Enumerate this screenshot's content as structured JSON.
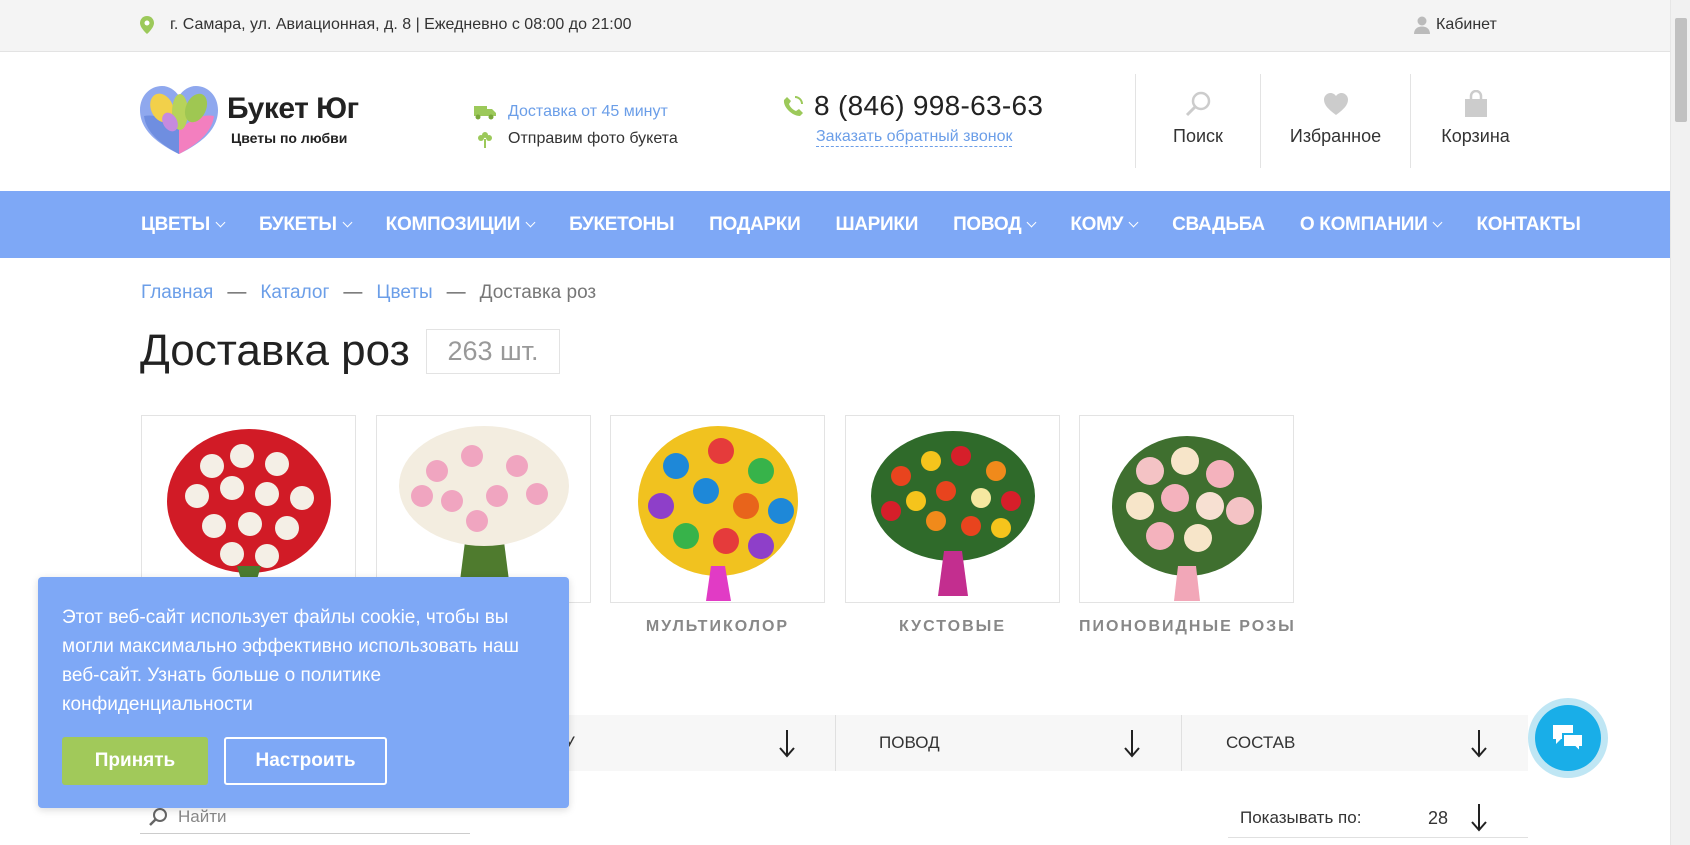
{
  "topbar": {
    "address": "г. Самара, ул. Авиационная, д. 8 | Ежедневно с 08:00 до 21:00",
    "cabinet": "Кабинет"
  },
  "logo": {
    "title": "Букет Юг",
    "subtitle": "Цветы по любви"
  },
  "delivery": {
    "time_link": "Доставка от 45 минут",
    "photo": "Отправим фото букета"
  },
  "phone": {
    "number": "8 (846) 998-63-63",
    "callback": "Заказать обратный звонок"
  },
  "header_buttons": {
    "search": "Поиск",
    "favorites": "Избранное",
    "cart": "Корзина"
  },
  "nav": [
    {
      "label": "ЦВЕТЫ",
      "dropdown": true
    },
    {
      "label": "БУКЕТЫ",
      "dropdown": true
    },
    {
      "label": "КОМПОЗИЦИИ",
      "dropdown": true
    },
    {
      "label": "БУКЕТОНЫ",
      "dropdown": false
    },
    {
      "label": "ПОДАРКИ",
      "dropdown": false
    },
    {
      "label": "ШАРИКИ",
      "dropdown": false
    },
    {
      "label": "ПОВОД",
      "dropdown": true
    },
    {
      "label": "КОМУ",
      "dropdown": true
    },
    {
      "label": "СВАДЬБА",
      "dropdown": false
    },
    {
      "label": "О КОМПАНИИ",
      "dropdown": true
    },
    {
      "label": "КОНТАКТЫ",
      "dropdown": false
    }
  ],
  "breadcrumb": {
    "items": [
      "Главная",
      "Каталог",
      "Цветы"
    ],
    "separator": "—",
    "current": "Доставка роз"
  },
  "page": {
    "title": "Доставка роз",
    "count": "263 шт."
  },
  "categories": [
    {
      "label": "",
      "image": "red-white-roses"
    },
    {
      "label": "",
      "image": "pink-white-roses"
    },
    {
      "label": "МУЛЬТИКОЛОР",
      "image": "rainbow-roses"
    },
    {
      "label": "КУСТОВЫЕ",
      "image": "spray-roses"
    },
    {
      "label": "ПИОНОВИДНЫЕ РОЗЫ",
      "image": "peony-roses"
    }
  ],
  "filters": {
    "first_fragment": "У",
    "occasion": "ПОВОД",
    "composition": "СОСТАВ"
  },
  "search": {
    "placeholder": "Найти"
  },
  "perpage": {
    "label": "Показывать по:",
    "value": "28"
  },
  "cookie": {
    "text": "Этот веб-сайт использует файлы cookie, чтобы вы могли максимально эффективно использовать наш веб-сайт. Узнать больше о политике конфиденциальности",
    "accept": "Принять",
    "configure": "Настроить"
  },
  "colors": {
    "nav_bg": "#7ea8f6",
    "link": "#6b9ee8",
    "accept": "#a1c95a",
    "chat": "#19aee8",
    "icon_green": "#9cc95a"
  }
}
